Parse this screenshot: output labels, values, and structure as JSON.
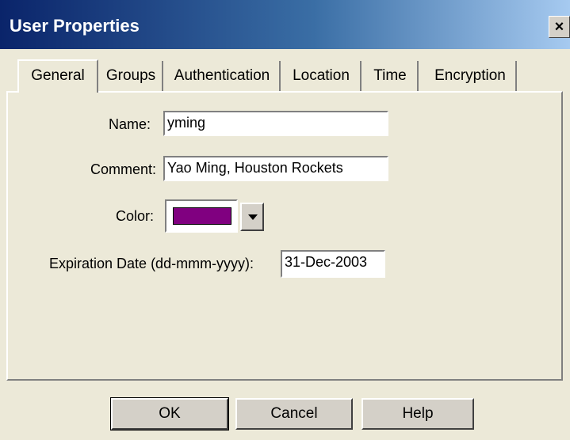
{
  "window": {
    "title": "User Properties",
    "close_label": "×"
  },
  "tabs": [
    {
      "label": "General",
      "active": true
    },
    {
      "label": "Groups",
      "active": false
    },
    {
      "label": "Authentication",
      "active": false
    },
    {
      "label": "Location",
      "active": false
    },
    {
      "label": "Time",
      "active": false
    },
    {
      "label": "Encryption",
      "active": false
    }
  ],
  "general": {
    "name_label": "Name:",
    "name_value": "yming",
    "comment_label": "Comment:",
    "comment_value": "Yao Ming, Houston Rockets",
    "color_label": "Color:",
    "color_value": "#800080",
    "expiration_label": "Expiration Date (dd-mmm-yyyy):",
    "expiration_value": "31-Dec-2003"
  },
  "buttons": {
    "ok": "OK",
    "cancel": "Cancel",
    "help": "Help"
  }
}
